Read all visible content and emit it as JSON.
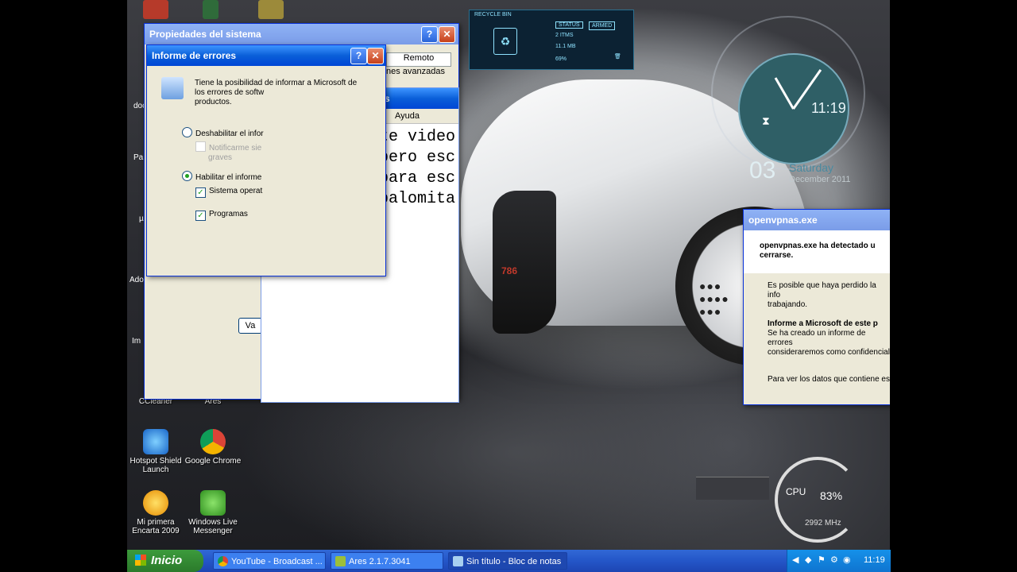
{
  "desktop": {
    "clock_widget": {
      "time": "11:19",
      "day": "03",
      "weekday": "Saturday",
      "month_year": "December 2011"
    },
    "recycle_gadget": {
      "title": "RECYCLE BIN",
      "status_label": "STATUS",
      "items": "2 ITMS",
      "size": "11.1 MB",
      "percent": "69%",
      "button": "ARMED"
    },
    "cpu_widget": {
      "label": "CPU",
      "percent": "83%",
      "freq": "2992 MHz"
    },
    "bike_number": "786",
    "icons": [
      {
        "label": "CCleaner"
      },
      {
        "label": "Ares"
      },
      {
        "label": "Hotspot Shield Launch"
      },
      {
        "label": "Google Chrome"
      },
      {
        "label": "Mi primera Encarta 2009"
      },
      {
        "label": "Windows Live Messenger"
      }
    ],
    "partial_icon_labels": [
      "doc",
      "Pa",
      "Ado",
      "Im",
      "µ"
    ]
  },
  "props_window": {
    "title": "Propiedades del sistema",
    "tab_remote": "Remoto",
    "opts_label": "nes avanzadas",
    "button_partial": "Va"
  },
  "error_dialog": {
    "title": "Informe de errores",
    "description_l1": "Tiene la posibilidad de  informar a Microsoft de",
    "description_l2": "los errores de softw",
    "description_l3": "productos.",
    "opt_disable": "Deshabilitar el infor",
    "opt_notify_l1": "Notificarme sie",
    "opt_notify_l2": "graves",
    "opt_enable": "Habilitar el informe",
    "opt_system": "Sistema operat",
    "opt_programs": "Programas"
  },
  "notepad": {
    "title": "s",
    "menu_help": "Ayuda",
    "lines": [
      "te video",
      "pero esc",
      "para esc",
      "palomita"
    ]
  },
  "openvpn_dialog": {
    "title": "openvpnas.exe",
    "header_l1": "openvpnas.exe ha detectado u",
    "header_l2": "cerrarse.",
    "body_1": "Es posible que haya perdido la info",
    "body_2": "trabajando.",
    "heading": "Informe a Microsoft de este p",
    "body_3": "Se ha creado un informe de errores",
    "body_4": "consideraremos como confidencial",
    "body_5": "Para ver los datos que contiene es"
  },
  "taskbar": {
    "start": "Inicio",
    "tasks": [
      {
        "label": "YouTube - Broadcast ..."
      },
      {
        "label": "Ares 2.1.7.3041"
      },
      {
        "label": "Sin título - Bloc de notas"
      }
    ],
    "time": "11:19"
  }
}
